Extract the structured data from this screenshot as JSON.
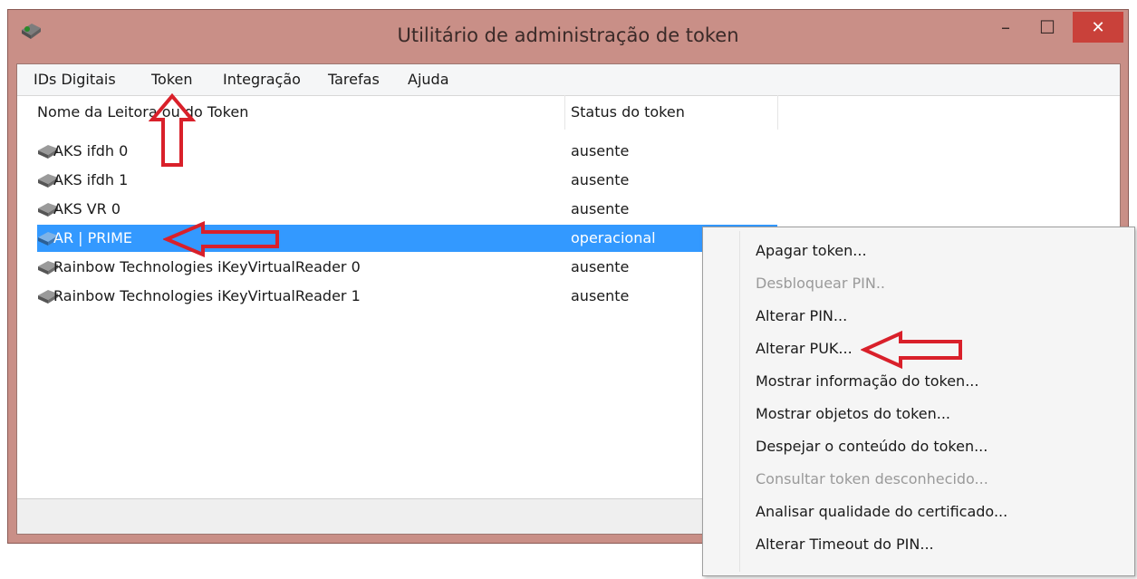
{
  "window": {
    "title": "Utilitário de administração de token",
    "minimize_glyph": "–",
    "maximize_glyph": "☐",
    "close_glyph": "✕",
    "accent_color": "#c98f87",
    "close_color": "#c9413a"
  },
  "menubar": {
    "items": [
      "IDs Digitais",
      "Token",
      "Integração",
      "Tarefas",
      "Ajuda"
    ]
  },
  "table": {
    "columns": [
      "Nome da Leitora ou do Token",
      "Status do token"
    ],
    "rows": [
      {
        "name": "AKS ifdh 0",
        "status": "ausente",
        "icon": "card-reader-icon"
      },
      {
        "name": "AKS ifdh 1",
        "status": "ausente",
        "icon": "card-reader-icon"
      },
      {
        "name": "AKS VR 0",
        "status": "ausente",
        "icon": "card-reader-icon"
      },
      {
        "name": "AR | PRIME",
        "status": "operacional",
        "icon": "token-icon",
        "selected": true
      },
      {
        "name": "Rainbow Technologies iKeyVirtualReader 0",
        "status": "ausente",
        "icon": "card-reader-icon"
      },
      {
        "name": "Rainbow Technologies iKeyVirtualReader 1",
        "status": "ausente",
        "icon": "card-reader-icon"
      }
    ],
    "selection_color": "#3399ff"
  },
  "context_menu": {
    "items": [
      {
        "label": "Apagar token...",
        "enabled": true
      },
      {
        "label": "Desbloquear PIN..",
        "enabled": false
      },
      {
        "label": "Alterar PIN...",
        "enabled": true
      },
      {
        "label": "Alterar PUK...",
        "enabled": true
      },
      {
        "label": "Mostrar informação do token...",
        "enabled": true
      },
      {
        "label": "Mostrar objetos do token...",
        "enabled": true
      },
      {
        "label": "Despejar o conteúdo do token...",
        "enabled": true
      },
      {
        "label": "Consultar token desconhecido...",
        "enabled": false
      },
      {
        "label": "Analisar qualidade do certificado...",
        "enabled": true
      },
      {
        "label": "Alterar Timeout do PIN...",
        "enabled": true
      }
    ]
  },
  "annotations": {
    "arrow_color": "#d9202a"
  }
}
